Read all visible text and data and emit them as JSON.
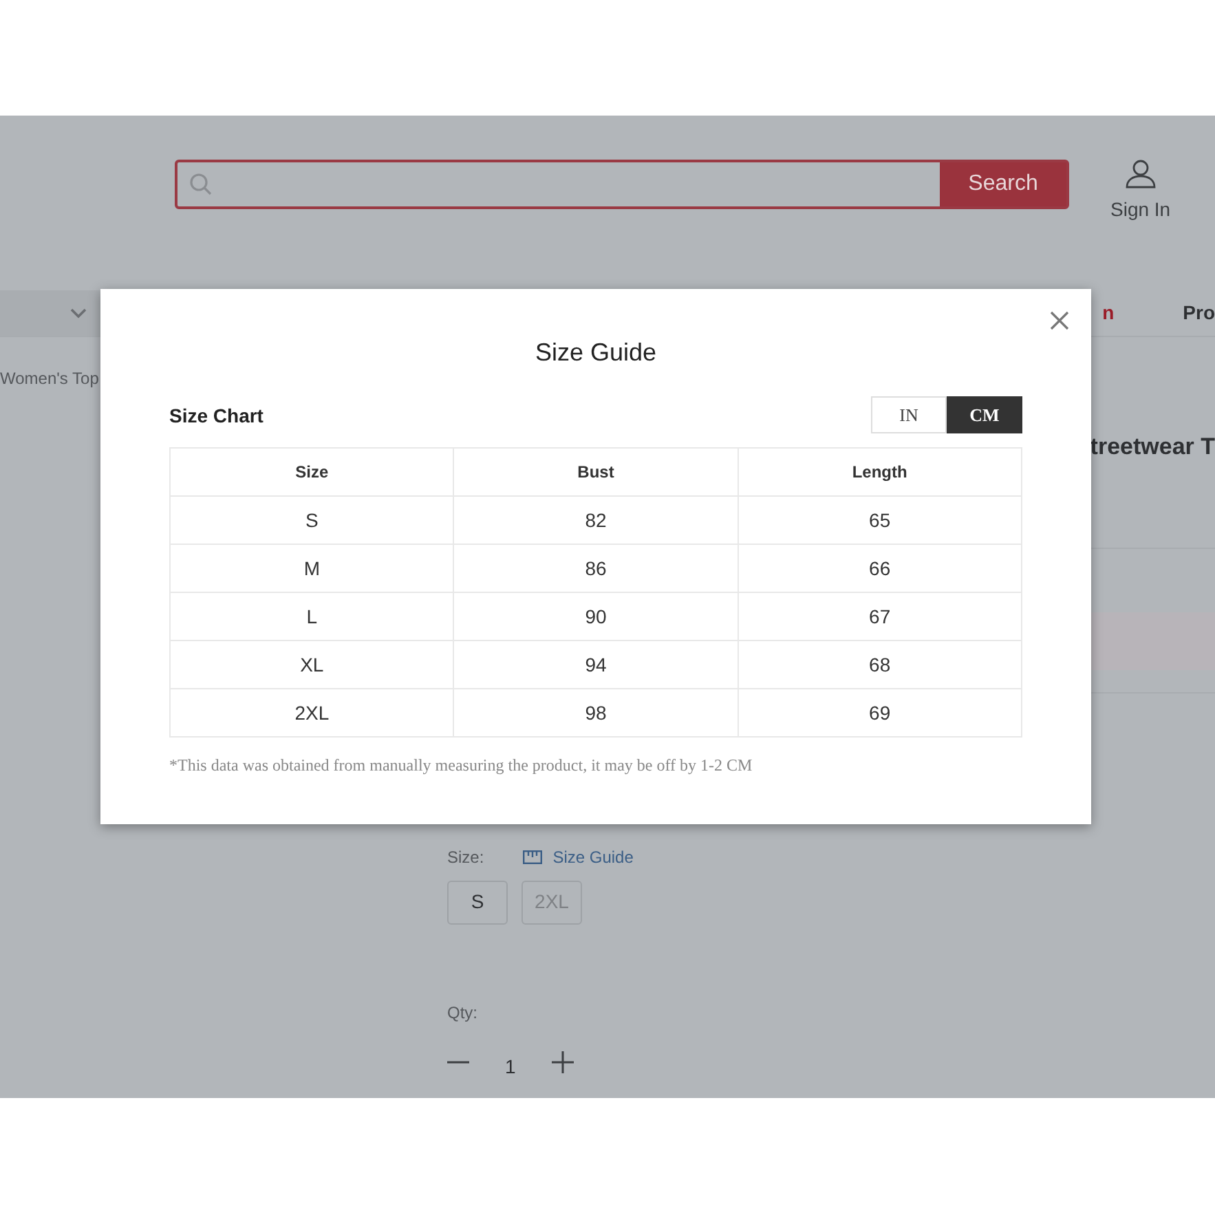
{
  "header": {
    "search_button": "Search",
    "account": "Sign In"
  },
  "nav": {
    "items": [
      {
        "label": "n",
        "highlighted": true
      },
      {
        "label": "Pro",
        "highlighted": false
      }
    ]
  },
  "breadcrumb": "Women's Top",
  "product_title": "treetwear T",
  "size_selector": {
    "label": "Size:",
    "guide_link": "Size Guide",
    "options": [
      {
        "label": "S",
        "disabled": false
      },
      {
        "label": "2XL",
        "disabled": true
      }
    ]
  },
  "quantity": {
    "label": "Qty:",
    "value": "1"
  },
  "modal": {
    "title": "Size Guide",
    "chart_title": "Size Chart",
    "units": [
      {
        "label": "IN",
        "selected": false
      },
      {
        "label": "CM",
        "selected": true
      }
    ],
    "columns": [
      "Size",
      "Bust",
      "Length"
    ],
    "rows": [
      [
        "S",
        "82",
        "65"
      ],
      [
        "M",
        "86",
        "66"
      ],
      [
        "L",
        "90",
        "67"
      ],
      [
        "XL",
        "94",
        "68"
      ],
      [
        "2XL",
        "98",
        "69"
      ]
    ],
    "note": "*This data was obtained from manually measuring the product, it may be off by 1-2 CM"
  }
}
